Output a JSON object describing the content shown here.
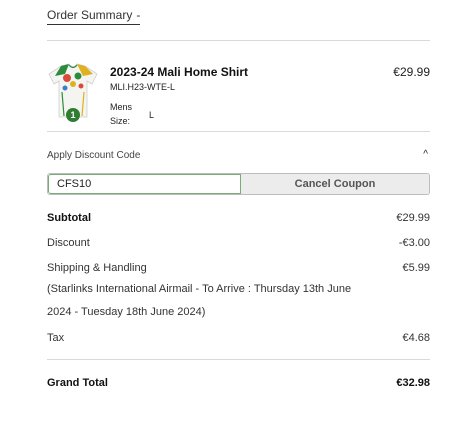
{
  "summary": {
    "title": "Order Summary",
    "chevron": "-"
  },
  "product": {
    "title": "2023-24 Mali Home Shirt",
    "sku": "MLI.H23-WTE-L",
    "category": "Mens",
    "size_label": "Size:",
    "size_value": "L",
    "price": "€29.99",
    "quantity": "1",
    "image_icon": "football-shirt-icon"
  },
  "discount": {
    "label": "Apply Discount Code",
    "caret": "^",
    "code_value": "CFS10",
    "cancel_label": "Cancel Coupon"
  },
  "totals": {
    "subtotal_label": "Subtotal",
    "subtotal_value": "€29.99",
    "discount_label": "Discount",
    "discount_value": "-€3.00",
    "shipping_label": "Shipping & Handling",
    "shipping_value": "€5.99",
    "shipping_note_line1": "(Starlinks International Airmail - To Arrive : Thursday 13th June",
    "shipping_note_line2": "2024 - Tuesday 18th June 2024)",
    "tax_label": "Tax",
    "tax_value": "€4.68",
    "grand_total_label": "Grand Total",
    "grand_total_value": "€32.98"
  },
  "colors": {
    "badge": "#2e7d32",
    "input_border": "#7aa97a",
    "button_bg": "#ececec"
  }
}
